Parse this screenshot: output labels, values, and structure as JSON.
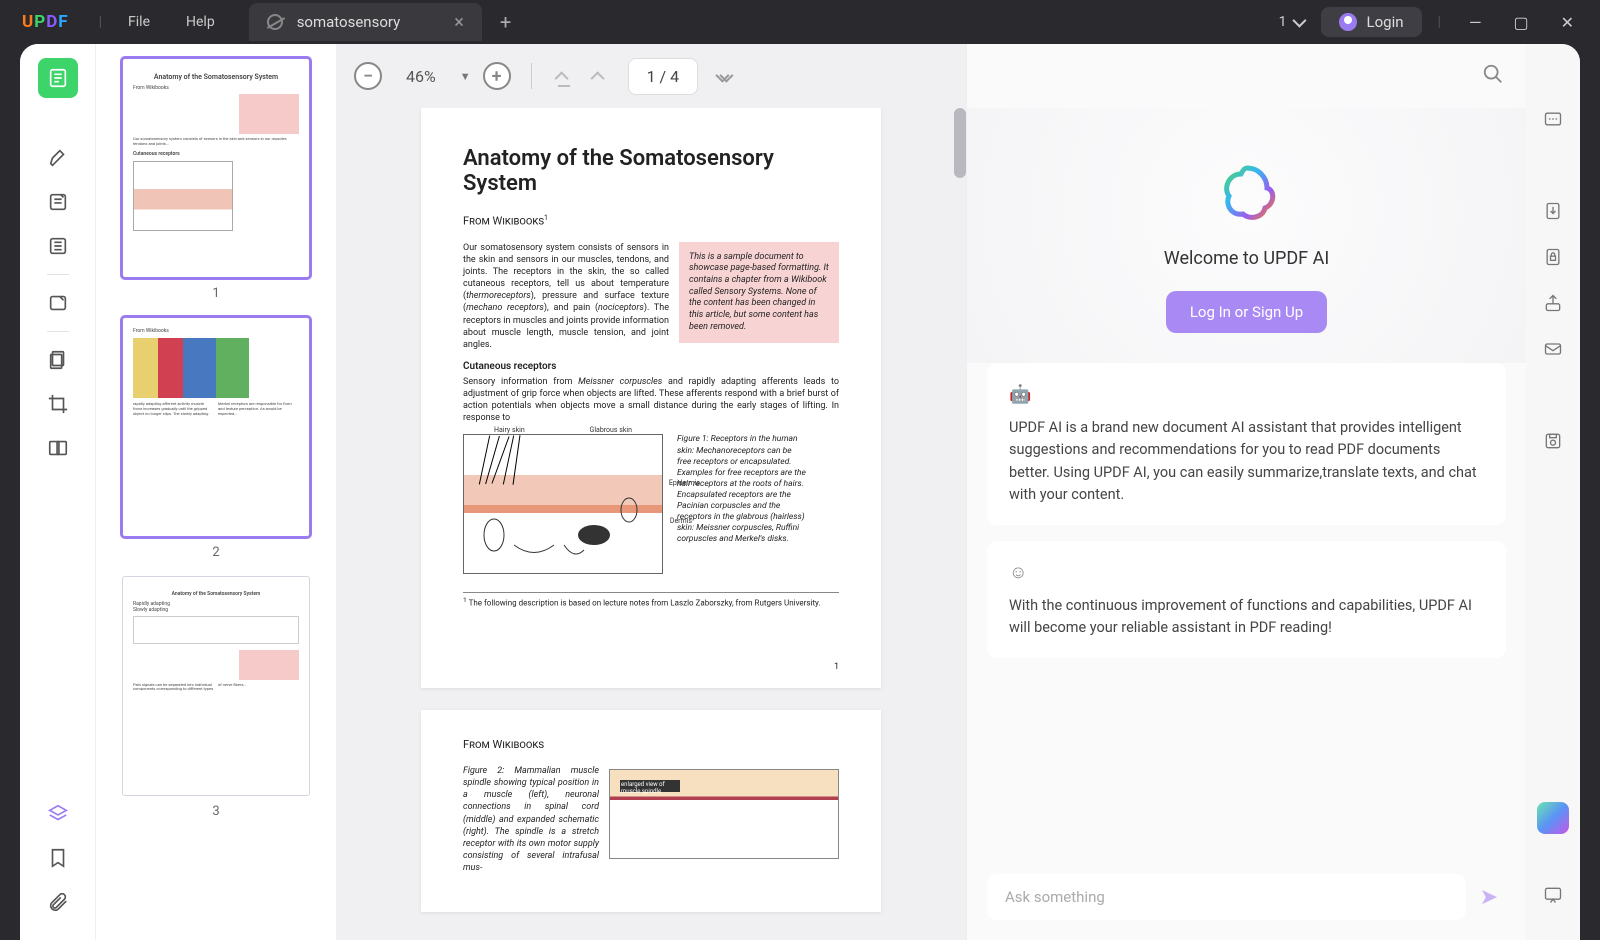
{
  "titlebar": {
    "logo": "UPDF",
    "menu_file": "File",
    "menu_help": "Help",
    "tab_title": "somatosensory",
    "credits": "1",
    "login": "Login"
  },
  "toolbar": {
    "zoom": "46%",
    "page_current": "1",
    "page_total": "4",
    "page_display": "1 / 4"
  },
  "thumbs": {
    "n1": "1",
    "n2": "2",
    "n3": "3",
    "title1": "Anatomy of the Somatosensory System"
  },
  "doc": {
    "title": "Anatomy of the Somatosensory System",
    "from": "From Wikibooks",
    "para1a": "Our somatosensory system consists of sensors in the skin and sensors in our muscles, tendons, and joints. The receptors in the skin, the so called cutaneous receptors, tell us about temperature (",
    "para1b": "thermoreceptors",
    "para1c": "), pressure and surface texture (",
    "para1d": "mechano receptors",
    "para1e": "), and pain (",
    "para1f": "nociceptors",
    "para1g": "). The receptors in muscles and joints provide information about muscle length, muscle tension, and joint angles.",
    "box": "This is a sample document to showcase page-based formatting. It contains a chapter from a Wikibook called Sensory Systems. None of the content has been changed in this article, but some content has been removed.",
    "sub1": "Cutaneous receptors",
    "para2": "Sensory information from Meissner corpuscles and rapidly adapting afferents leads to adjustment of grip force when objects are lifted. These afferents respond with a brief burst of action potentials when objects move a small distance during the early stages of lifting. In response to",
    "figcap1": "Figure 1: Receptors in the human skin: Mechanoreceptors can be free receptors or encapsulated. Examples for free receptors are the hair receptors at the roots of hairs. Encapsulated receptors are the Pacinian corpuscles and the receptors in the glabrous (hairless) skin: Meissner corpuscles, Ruffini corpuscles and Merkel's disks.",
    "footnote": "The following description is based on lecture notes from Laszlo Zaborszky, from Rutgers University.",
    "pgnum": "1",
    "dia_hairy": "Hairy skin",
    "dia_glab": "Glabrous skin",
    "dia_epi": "Epidermis",
    "dia_dermis": "Dermis",
    "p2_from": "From Wikibooks",
    "p2_fig": "Figure 2: Mammalian muscle spindle showing typical position in a muscle (left), neuronal connections in spinal cord (middle) and expanded schematic (right). The spindle is a stretch receptor with its own motor supply consisting of several intrafusal mus-"
  },
  "ai": {
    "welcome": "Welcome to UPDF AI",
    "login_cta": "Log In or Sign Up",
    "card1": "UPDF AI is a brand new document AI assistant that provides intelligent suggestions and recommendations for you to read PDF documents better. Using UPDF AI, you can easily summarize,translate texts, and chat with your content.",
    "card2": "With the continuous improvement of functions and capabilities, UPDF AI will become your reliable assistant in PDF reading!",
    "placeholder": "Ask something"
  }
}
